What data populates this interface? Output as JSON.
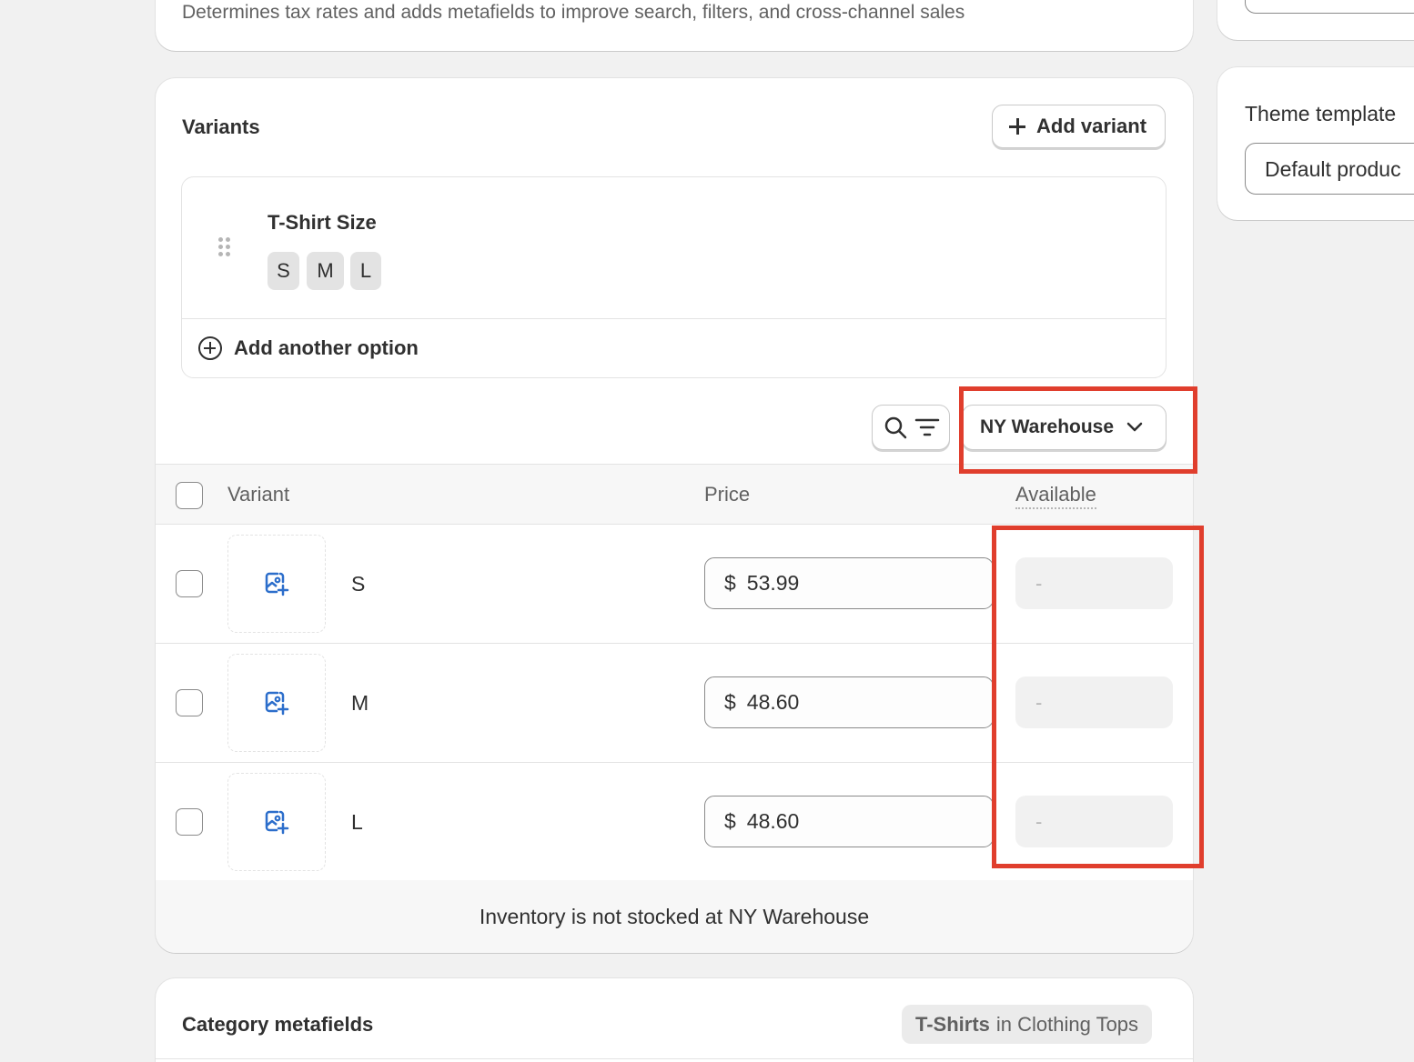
{
  "top_card": {
    "description": "Determines tax rates and adds metafields to improve search, filters, and cross-channel sales"
  },
  "theme": {
    "label": "Theme template",
    "value": "Default produc"
  },
  "variants": {
    "title": "Variants",
    "add_variant_label": "Add variant",
    "option": {
      "name": "T-Shirt Size",
      "values": [
        "S",
        "M",
        "L"
      ]
    },
    "add_option_label": "Add another option",
    "location": "NY Warehouse",
    "table": {
      "headers": {
        "variant": "Variant",
        "price": "Price",
        "available": "Available"
      },
      "rows": [
        {
          "name": "S",
          "currency": "$",
          "price": "53.99",
          "available": "-"
        },
        {
          "name": "M",
          "currency": "$",
          "price": "48.60",
          "available": "-"
        },
        {
          "name": "L",
          "currency": "$",
          "price": "48.60",
          "available": "-"
        }
      ],
      "footer": "Inventory is not stocked at NY Warehouse"
    }
  },
  "category_metafields": {
    "title": "Category metafields",
    "badge_strong": "T-Shirts",
    "badge_rest": "in Clothing Tops"
  },
  "colors": {
    "highlight": "#e03e2d",
    "image_icon": "#2c6ecb"
  },
  "icons": [
    "plus-icon",
    "drag-handle-icon",
    "circle-plus-icon",
    "search-icon",
    "filter-icon",
    "chevron-down-icon",
    "image-add-icon"
  ]
}
